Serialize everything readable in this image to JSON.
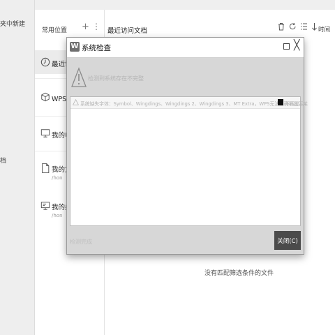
{
  "left_strip": {
    "new_in_label": "夹中新建",
    "edge_char": "档"
  },
  "locations": {
    "header": "常用位置",
    "add_icon": "plus-icon",
    "more_icon": "more-vertical-icon",
    "items": [
      {
        "label": "最近访问",
        "icon": "clock-icon",
        "selected": true
      },
      {
        "label": "WPS云文",
        "icon": "cube-icon"
      },
      {
        "label": "我的电脑",
        "icon": "monitor-icon"
      },
      {
        "label": "我的文档",
        "sub": "/hon",
        "icon": "document-icon"
      },
      {
        "label": "我的桌面",
        "sub": "/hon",
        "icon": "desktop-icon"
      }
    ]
  },
  "main": {
    "title": "最近访问文档",
    "sort_label": "时间",
    "empty_message": "没有匹配筛选条件的文件"
  },
  "dialog": {
    "title": "系统检查",
    "summary": "检测到系统存在不完整",
    "row_text": "系统缺失字体：Symbol、Wingdings、Wingdings 2、Wingdings 3、MT Extra，WPS无法正确地显示某",
    "row_checkbox_label": "不再提示",
    "status": "检测完成",
    "close_button": "关闭(C)"
  },
  "colors": {
    "close_button_bg": "#4b4b4b",
    "dialog_bg": "#d7d7d7"
  }
}
